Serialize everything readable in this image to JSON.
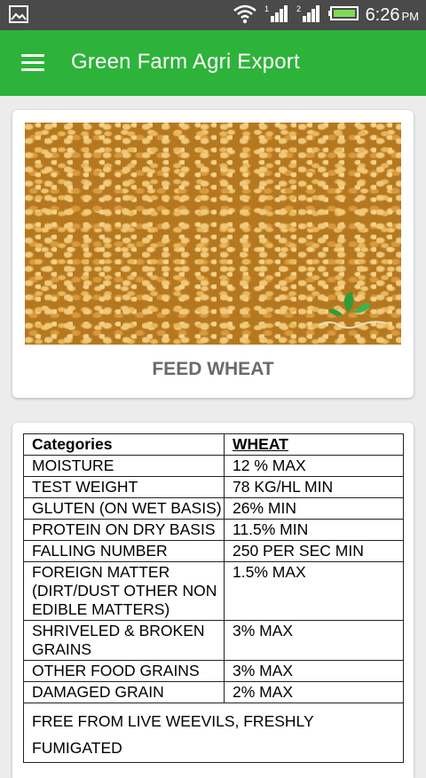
{
  "status_bar": {
    "time": "6:26",
    "ampm": "PM",
    "icons": [
      "image-icon",
      "wifi-icon",
      "signal-icon",
      "signal-2-icon",
      "battery-icon"
    ]
  },
  "app_bar": {
    "title": "Green Farm Agri Export",
    "menu_icon": "hamburger-menu-icon",
    "color": "#2db33a"
  },
  "product": {
    "name": "FEED WHEAT",
    "image": "wheat-grains-photo"
  },
  "specs": {
    "headers": [
      "Categories",
      "WHEAT"
    ],
    "rows": [
      [
        "MOISTURE",
        "12 % MAX"
      ],
      [
        "TEST WEIGHT",
        "78 KG/HL MIN"
      ],
      [
        "GLUTEN (ON WET BASIS)",
        "26% MIN"
      ],
      [
        "PROTEIN ON DRY BASIS",
        "11.5% MIN"
      ],
      [
        "FALLING NUMBER",
        "250 PER SEC MIN"
      ],
      [
        "FOREIGN MATTER (DIRT/DUST OTHER NON EDIBLE MATTERS)",
        "1.5% MAX"
      ],
      [
        "SHRIVELED & BROKEN GRAINS",
        "3% MAX"
      ],
      [
        "OTHER FOOD GRAINS",
        "3% MAX"
      ],
      [
        "DAMAGED GRAIN",
        "2% MAX"
      ]
    ],
    "note": "FREE FROM LIVE WEEVILS, FRESHLY FUMIGATED"
  }
}
